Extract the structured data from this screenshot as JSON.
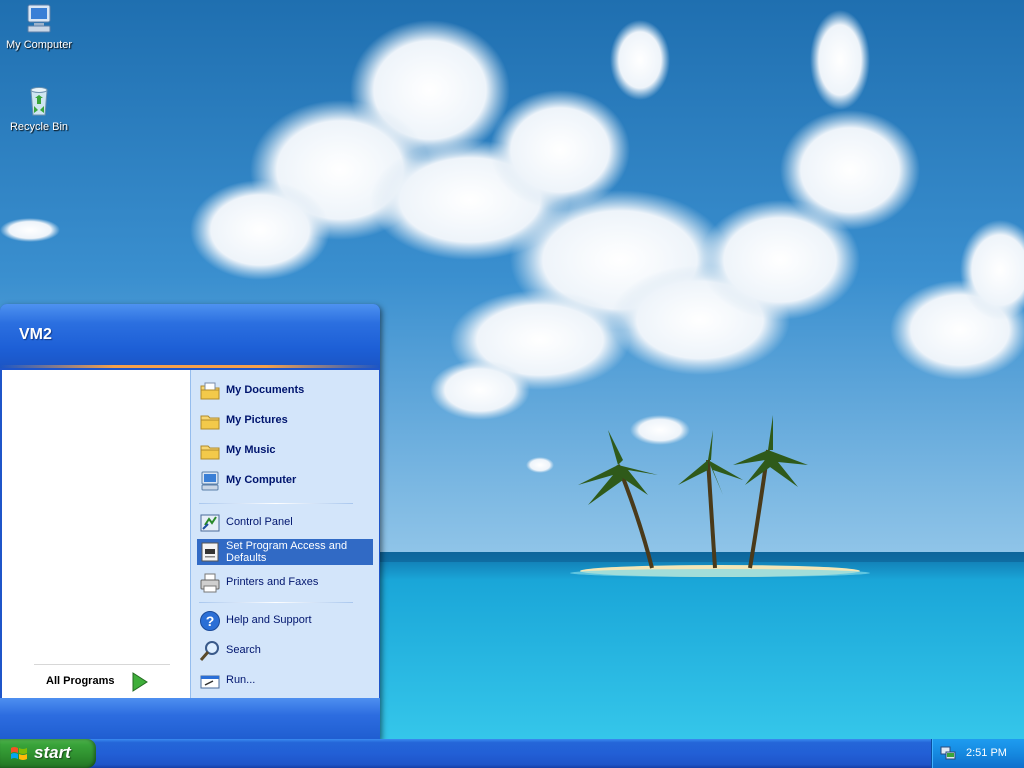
{
  "desktop": {
    "icons": [
      {
        "label": "My Computer",
        "icon": "my-computer-icon"
      },
      {
        "label": "Recycle Bin",
        "icon": "recycle-bin-icon"
      }
    ]
  },
  "start_menu": {
    "user_name": "VM2",
    "all_programs_label": "All Programs",
    "right_items": [
      {
        "label": "My Documents",
        "icon": "folder-documents-icon",
        "bold": true
      },
      {
        "label": "My Pictures",
        "icon": "folder-icon",
        "bold": true
      },
      {
        "label": "My Music",
        "icon": "folder-icon",
        "bold": true
      },
      {
        "label": "My Computer",
        "icon": "my-computer-icon",
        "bold": true
      },
      {
        "label": "Control Panel",
        "icon": "control-panel-icon",
        "bold": false
      },
      {
        "label": "Set Program Access and Defaults",
        "icon": "program-access-icon",
        "bold": false,
        "selected": true
      },
      {
        "label": "Printers and Faxes",
        "icon": "printer-icon",
        "bold": false
      },
      {
        "label": "Help and Support",
        "icon": "help-icon",
        "bold": false
      },
      {
        "label": "Search",
        "icon": "search-icon",
        "bold": false
      },
      {
        "label": "Run...",
        "icon": "run-icon",
        "bold": false
      }
    ]
  },
  "taskbar": {
    "start_label": "start",
    "clock": "2:51 PM"
  },
  "colors": {
    "selection": "#316ac5",
    "taskbar_blue": "#225fd6",
    "start_green": "#39a33a"
  }
}
